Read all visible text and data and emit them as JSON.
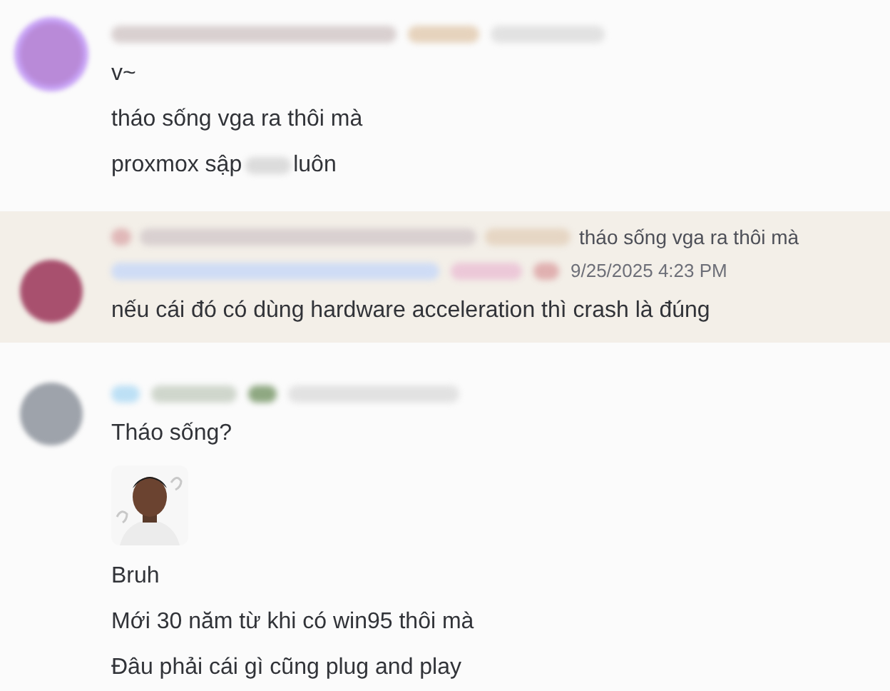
{
  "messages": [
    {
      "highlighted": false,
      "lines": [
        {
          "kind": "text",
          "text": "v~"
        },
        {
          "kind": "text",
          "text": "tháo sống vga ra thôi mà"
        },
        {
          "kind": "redacted",
          "before": "proxmox sập",
          "after": "luôn"
        }
      ]
    },
    {
      "highlighted": true,
      "reply_preview": "tháo sống vga ra thôi mà",
      "timestamp": "9/25/2025 4:23 PM",
      "lines": [
        {
          "kind": "text",
          "text": "nếu cái đó có dùng hardware acceleration thì crash là đúng"
        }
      ]
    },
    {
      "highlighted": false,
      "lines": [
        {
          "kind": "text",
          "text": "Tháo sống?"
        },
        {
          "kind": "sticker"
        },
        {
          "kind": "text",
          "text": "Bruh"
        },
        {
          "kind": "text",
          "text": "Mới 30 năm từ khi có win95 thôi mà"
        },
        {
          "kind": "text",
          "text": "Đâu phải cái gì cũng plug and play"
        }
      ]
    }
  ]
}
